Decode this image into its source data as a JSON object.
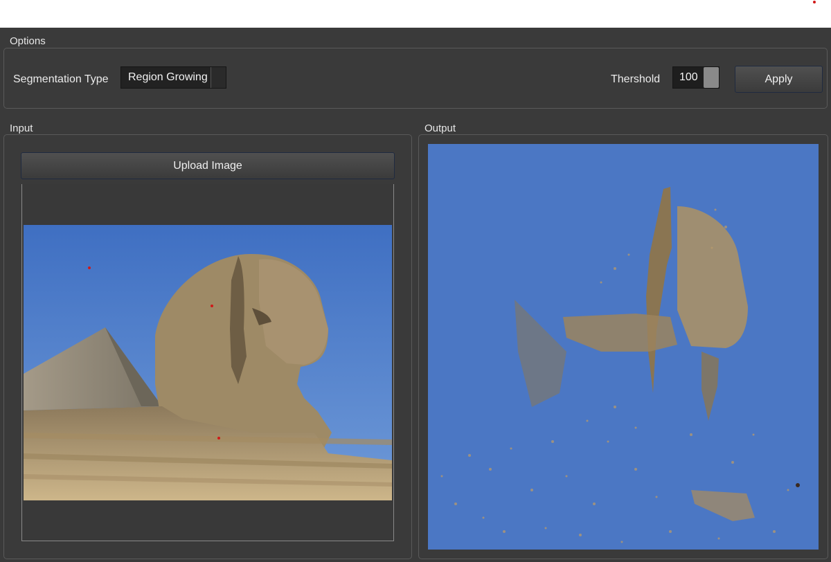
{
  "options": {
    "group_title": "Options",
    "segmentation_label": "Segmentation Type",
    "segmentation_value": "Region Growing",
    "threshold_label": "Thershold",
    "threshold_value": "100",
    "apply_label": "Apply"
  },
  "input": {
    "group_title": "Input",
    "upload_label": "Upload Image",
    "image_icon": "sphinx-photo"
  },
  "output": {
    "group_title": "Output",
    "image_icon": "segmented-sphinx-photo"
  },
  "colors": {
    "background": "#3a3a3a",
    "sky": "#4a79c8",
    "stone": "#b59a6e",
    "seed_point": "#d01818"
  }
}
